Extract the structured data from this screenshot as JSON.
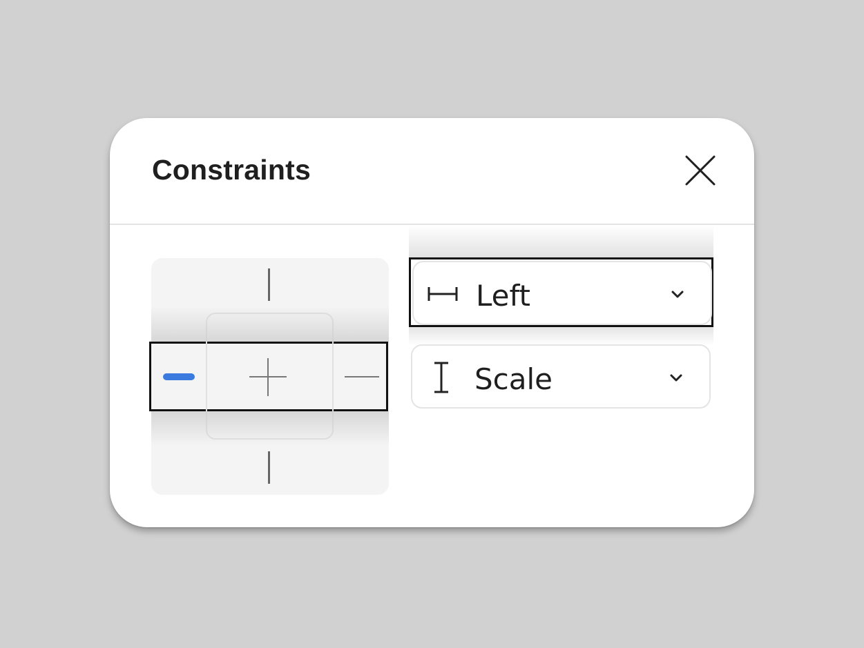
{
  "dialog": {
    "title": "Constraints",
    "close_icon": "close-icon"
  },
  "constraint_widget": {
    "horizontal_selected": "left",
    "accent_color": "#3b7be0",
    "handle_color": "#666666"
  },
  "horizontal_dropdown": {
    "icon": "horizontal-pin-icon",
    "value": "Left",
    "chevron": "chevron-down-icon"
  },
  "vertical_dropdown": {
    "icon": "vertical-scale-icon",
    "value": "Scale",
    "chevron": "chevron-down-icon"
  }
}
